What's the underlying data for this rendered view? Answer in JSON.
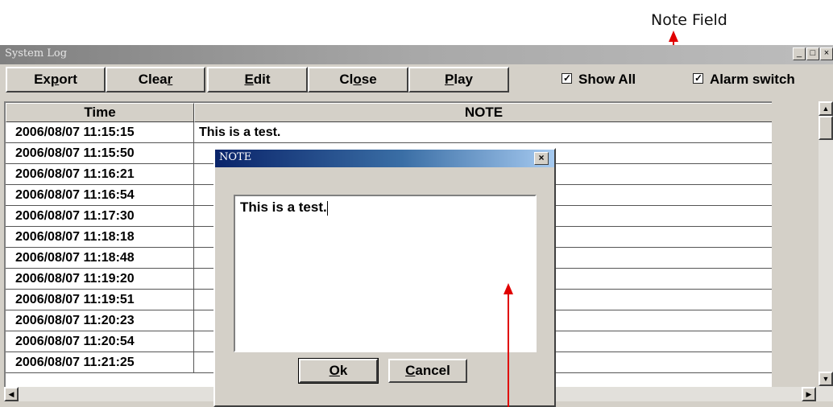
{
  "annotation": {
    "label": "Note Field",
    "color": "#e00000"
  },
  "window": {
    "title": "System Log",
    "minimize": "_",
    "maximize": "□",
    "close": "×"
  },
  "toolbar": {
    "export_label": [
      "Ex",
      "p",
      "ort"
    ],
    "clear_label": [
      "Clea",
      "r",
      ""
    ],
    "edit_label": [
      "",
      "E",
      "dit"
    ],
    "close_label": [
      "Cl",
      "o",
      "se"
    ],
    "play_label": [
      "",
      "P",
      "lay"
    ],
    "show_all": {
      "label": "Show All",
      "checked": true
    },
    "alarm_switch": {
      "label": "Alarm switch",
      "checked": true
    }
  },
  "table": {
    "headers": {
      "time": "Time",
      "note": "NOTE"
    },
    "rows": [
      {
        "time": "2006/08/07 11:15:15",
        "note": "This is a test."
      },
      {
        "time": "2006/08/07 11:15:50",
        "note": ""
      },
      {
        "time": "2006/08/07 11:16:21",
        "note": ""
      },
      {
        "time": "2006/08/07 11:16:54",
        "note": ""
      },
      {
        "time": "2006/08/07 11:17:30",
        "note": ""
      },
      {
        "time": "2006/08/07 11:18:18",
        "note": ""
      },
      {
        "time": "2006/08/07 11:18:48",
        "note": ""
      },
      {
        "time": "2006/08/07 11:19:20",
        "note": ""
      },
      {
        "time": "2006/08/07 11:19:51",
        "note": ""
      },
      {
        "time": "2006/08/07 11:20:23",
        "note": ""
      },
      {
        "time": "2006/08/07 11:20:54",
        "note": ""
      },
      {
        "time": "2006/08/07 11:21:25",
        "note": ""
      }
    ]
  },
  "dialog": {
    "title": "NOTE",
    "close": "×",
    "text": "This is a test.",
    "ok_label": [
      "",
      "O",
      "k"
    ],
    "cancel_label": [
      "",
      "C",
      "ancel"
    ]
  }
}
